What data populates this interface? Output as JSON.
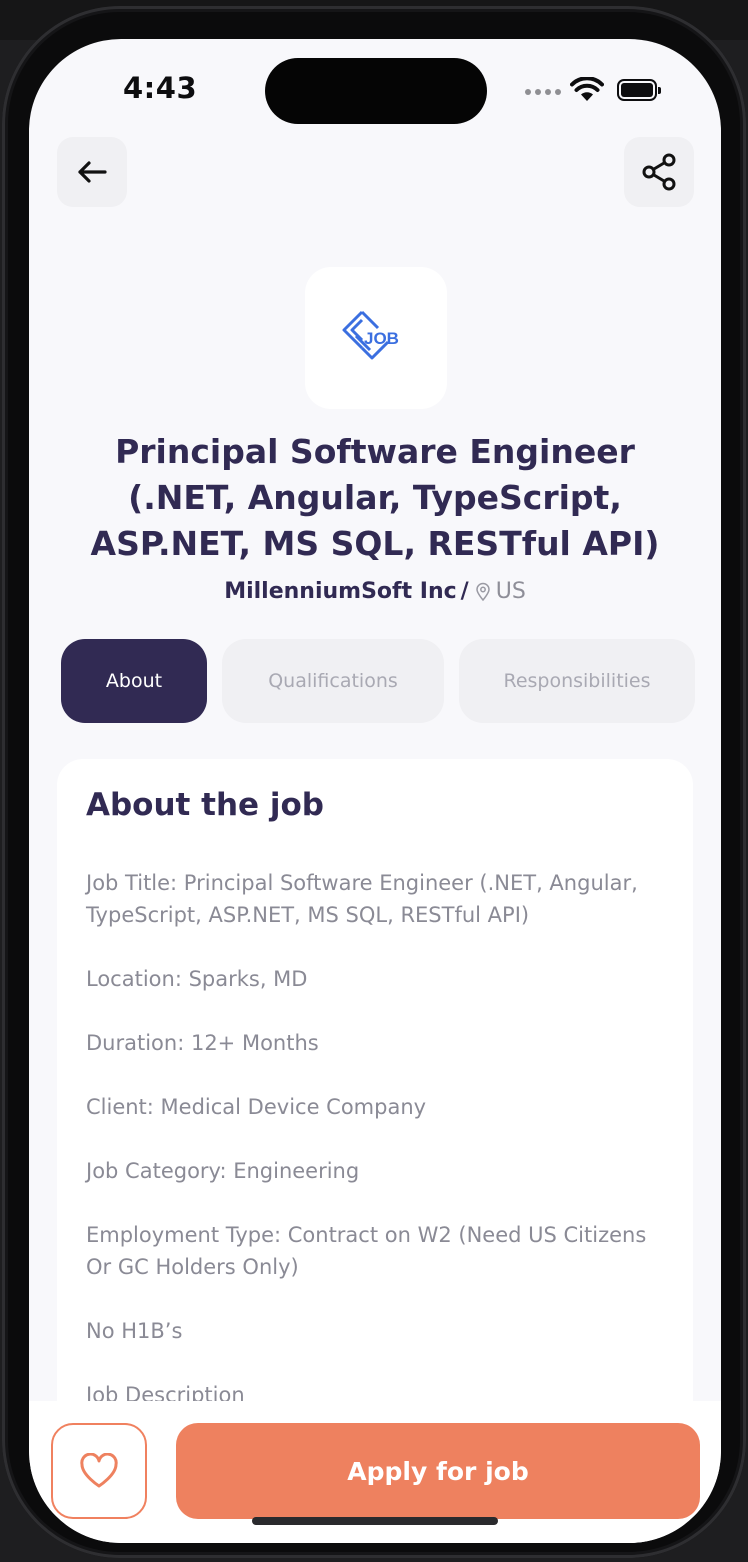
{
  "status_bar": {
    "time": "4:43"
  },
  "header": {
    "back_icon": "arrow-left-icon",
    "share_icon": "share-icon"
  },
  "company_logo": {
    "text": "JOB",
    "color": "#3b6fe0"
  },
  "job": {
    "title": "Principal Software Engineer (.NET, Angular, TypeScript, ASP.NET, MS SQL, RESTful API)",
    "company": "MillenniumSoft Inc",
    "separator": "/",
    "country": "US"
  },
  "tabs": [
    {
      "label": "About",
      "active": true
    },
    {
      "label": "Qualifications",
      "active": false
    },
    {
      "label": "Responsibilities",
      "active": false
    }
  ],
  "about": {
    "heading": "About the job",
    "paragraphs": [
      "Job Title: Principal Software Engineer (.NET, Angular, TypeScript, ASP.NET, MS SQL, RESTful API)",
      "Location: Sparks, MD",
      "Duration: 12+ Months",
      "Client: Medical Device Company",
      "Job Category: Engineering",
      "Employment Type: Contract on W2 (Need US Citizens Or GC Holders Only)",
      "No H1B’s",
      "Job Description"
    ]
  },
  "footer": {
    "favorite_icon": "heart-icon",
    "apply_label": "Apply for job"
  },
  "colors": {
    "primary": "#312a53",
    "accent": "#ee815f",
    "muted_text": "#8a8a95",
    "background": "#f8f8fb"
  }
}
